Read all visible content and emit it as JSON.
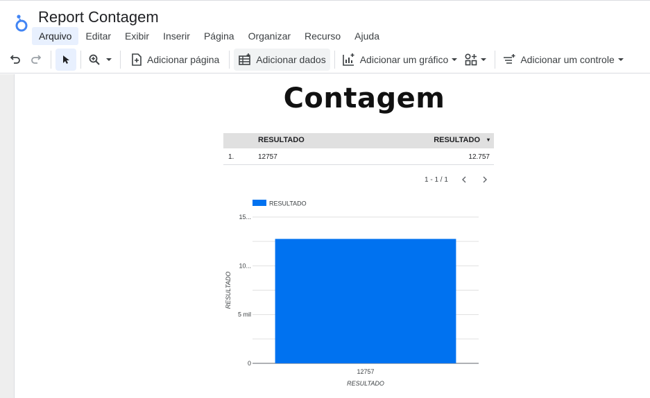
{
  "app": {
    "report_title": "Report Contagem"
  },
  "menu": [
    "Arquivo",
    "Editar",
    "Exibir",
    "Inserir",
    "Página",
    "Organizar",
    "Recurso",
    "Ajuda"
  ],
  "toolbar": {
    "add_page": "Adicionar página",
    "add_data": "Adicionar dados",
    "add_chart": "Adicionar um gráfico",
    "add_control": "Adicionar um controle"
  },
  "page": {
    "heading": "Contagem"
  },
  "table": {
    "headers": {
      "dimension": "RESULTADO",
      "metric": "RESULTADO",
      "sort_icon": "▾"
    },
    "rows": [
      {
        "index": "1.",
        "dimension": "12757",
        "metric": "12.757"
      }
    ],
    "pagination": "1 - 1 / 1"
  },
  "colors": {
    "bar": "#0072f0",
    "accent": "#1a73e8",
    "selected_bg": "#e8f0fe"
  },
  "chart_data": {
    "type": "bar",
    "categories": [
      "12757"
    ],
    "series": [
      {
        "name": "RESULTADO",
        "values": [
          12757
        ]
      }
    ],
    "xlabel": "RESULTADO",
    "ylabel": "RESULTADO",
    "ylim": [
      0,
      15000
    ],
    "y_ticks": [
      {
        "value": 0,
        "label": "0"
      },
      {
        "value": 5000,
        "label": "5 mil"
      },
      {
        "value": 10000,
        "label": "10..."
      },
      {
        "value": 15000,
        "label": "15..."
      }
    ],
    "legend": "top-left",
    "grid": true
  }
}
